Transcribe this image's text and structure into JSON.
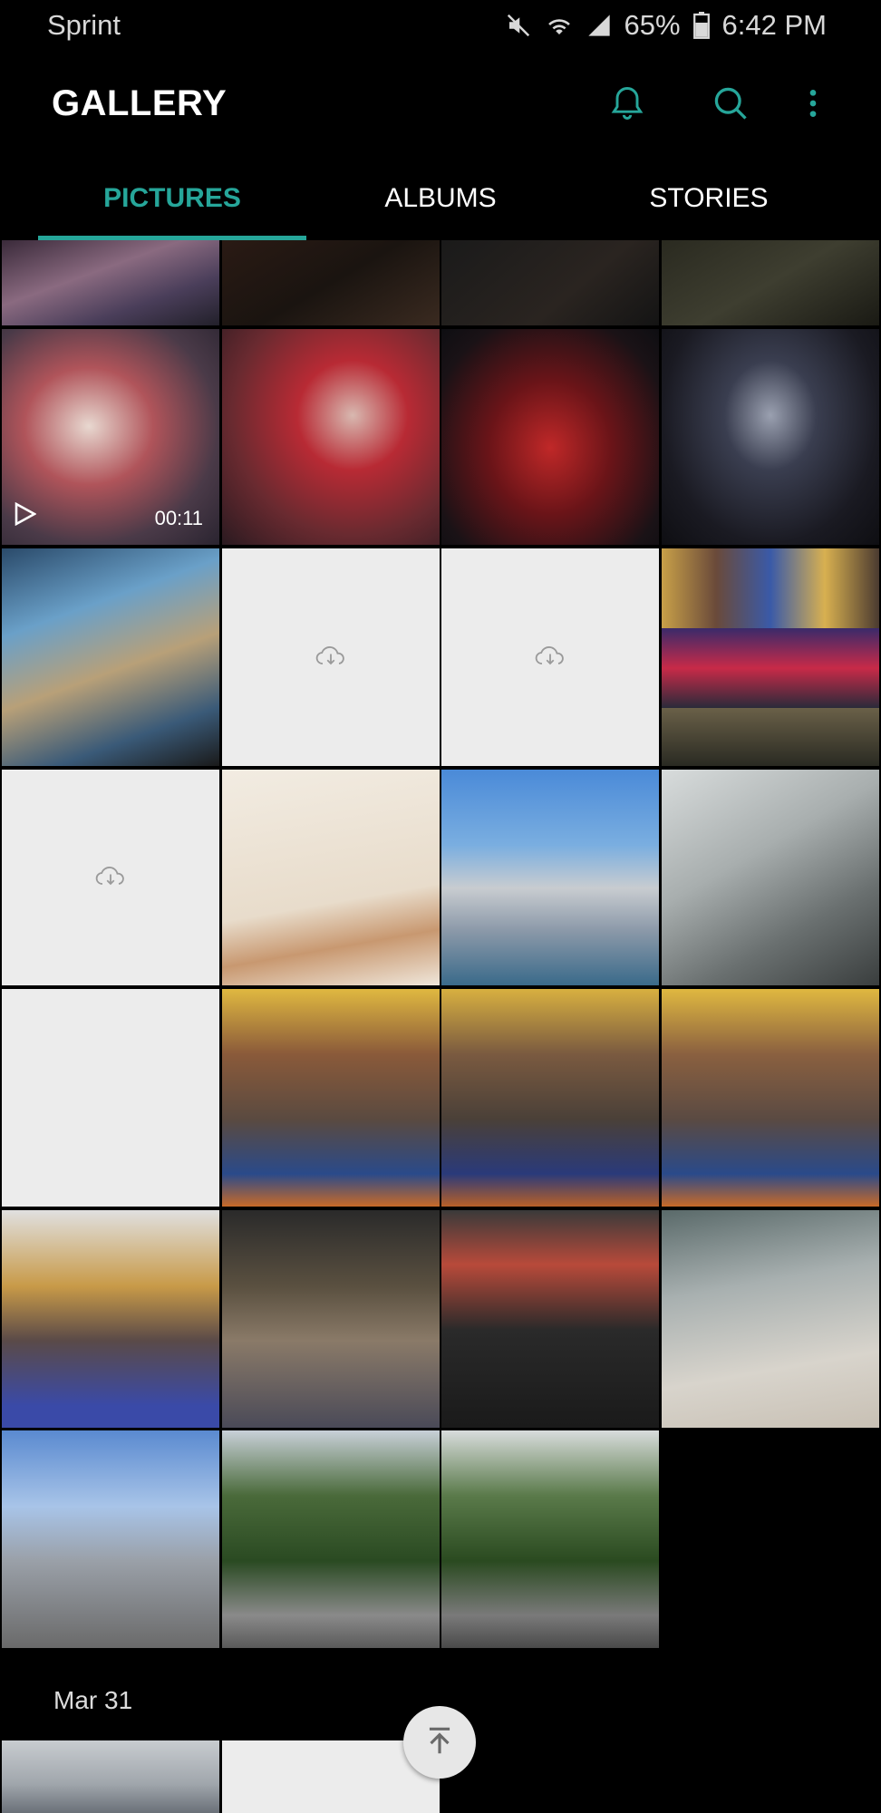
{
  "status_bar": {
    "carrier": "Sprint",
    "battery": "65%",
    "time": "6:42 PM",
    "icons": [
      "mute-icon",
      "wifi-icon",
      "signal-icon",
      "battery-icon"
    ]
  },
  "app_bar": {
    "title": "GALLERY",
    "accent_color": "#26a69a",
    "actions": [
      "bell-icon",
      "search-icon",
      "more-icon"
    ]
  },
  "tabs": [
    {
      "label": "PICTURES",
      "active": true
    },
    {
      "label": "ALBUMS",
      "active": false
    },
    {
      "label": "STORIES",
      "active": false
    }
  ],
  "grid": {
    "video": {
      "duration": "00:11"
    },
    "placeholders": [
      "cloud-download-icon"
    ]
  },
  "section": {
    "date": "Mar 31"
  }
}
